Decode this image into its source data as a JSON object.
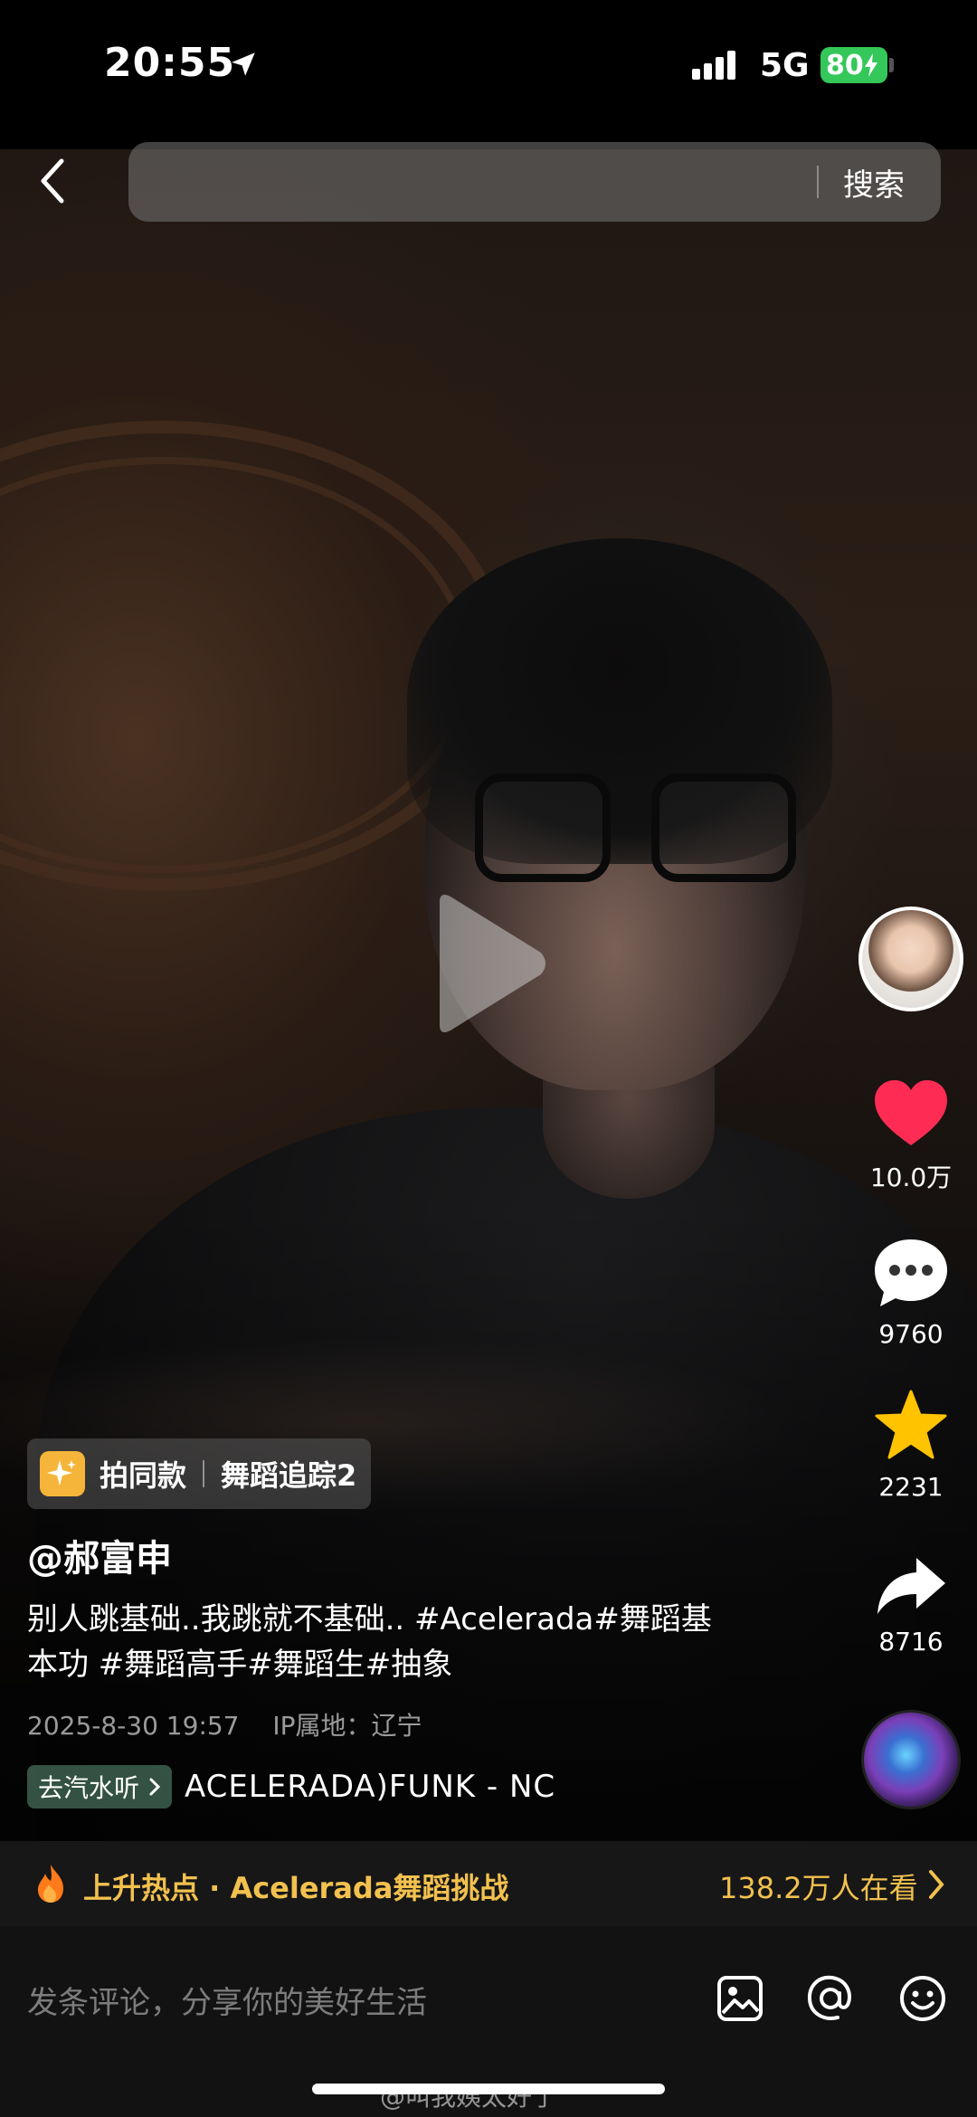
{
  "status_bar": {
    "time": "20:55",
    "network": "5G",
    "battery": "80"
  },
  "search": {
    "placeholder": "",
    "button_label": "搜索"
  },
  "actions": {
    "likes": "10.0万",
    "comments": "9760",
    "favorites": "2231",
    "shares": "8716"
  },
  "same_style": {
    "label": "拍同款",
    "tag": "舞蹈追踪2"
  },
  "post": {
    "author": "@郝富申",
    "description_line1": "别人跳基础..我跳就不基础.. #Acelerada#舞蹈基",
    "description_line2": "本功 #舞蹈高手#舞蹈生#抽象",
    "date": "2025-8-30 19:57",
    "ip_location": "IP属地：辽宁"
  },
  "music": {
    "chip_label": "去汽水听",
    "title": "ACELERADA)FUNK - NC"
  },
  "hot_topic": {
    "title": "上升热点 · Acelerada舞蹈挑战",
    "viewers": "138.2万人在看"
  },
  "comment": {
    "placeholder": "发条评论，分享你的美好生活"
  },
  "watermark": "@叫我姨太好了",
  "colors": {
    "like_red": "#fe2c55",
    "favorite_yellow": "#ffc300",
    "hot_gold": "#f2c14e",
    "battery_green": "#34c759"
  }
}
